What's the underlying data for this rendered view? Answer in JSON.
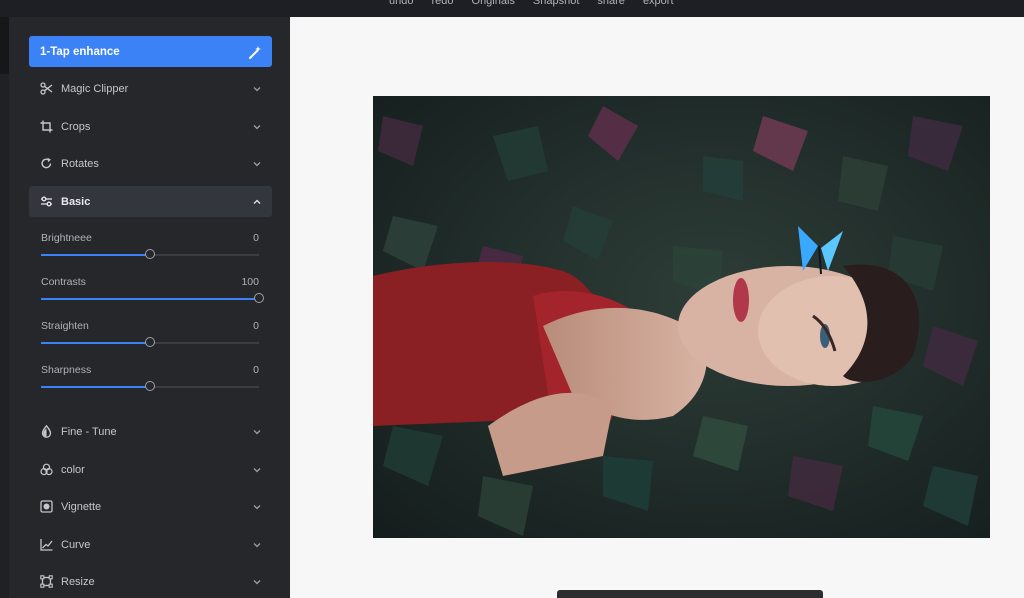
{
  "topbar": {
    "menu": [
      "undo",
      "redo",
      "Originals",
      "Snapshot",
      "share",
      "export"
    ]
  },
  "sidebar": {
    "enhance_label": "1-Tap enhance",
    "items": [
      {
        "label": "Magic Clipper",
        "icon": "scissors-icon"
      },
      {
        "label": "Crops",
        "icon": "crop-icon"
      },
      {
        "label": "Rotates",
        "icon": "rotate-icon"
      },
      {
        "label": "Basic",
        "icon": "sliders-icon",
        "expanded": true
      },
      {
        "label": "Fine - Tune",
        "icon": "drop-icon"
      },
      {
        "label": "color",
        "icon": "color-circles-icon"
      },
      {
        "label": "Vignette",
        "icon": "vignette-icon"
      },
      {
        "label": "Curve",
        "icon": "curve-icon"
      },
      {
        "label": "Resize",
        "icon": "resize-icon"
      }
    ],
    "sliders": [
      {
        "label": "Brightneee",
        "value": "0",
        "fraction": 0.5
      },
      {
        "label": "Contrasts",
        "value": "100",
        "fraction": 1.0
      },
      {
        "label": "Straighten",
        "value": "0",
        "fraction": 0.5
      },
      {
        "label": "Sharpness",
        "value": "0",
        "fraction": 0.5
      }
    ]
  },
  "colors": {
    "accent": "#3b82f6",
    "sidebar_bg": "#25272b",
    "canvas_bg": "#f7f7f8"
  }
}
